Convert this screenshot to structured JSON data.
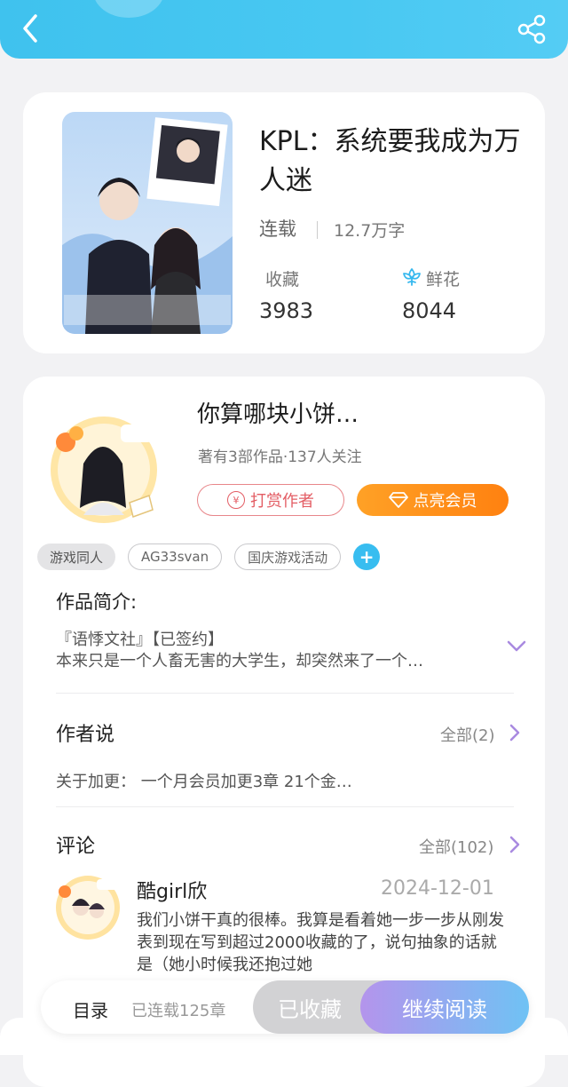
{
  "colors": {
    "header": "#45c6f1",
    "accent_orange": "#ff8a1a",
    "accent_red": "#e35d64",
    "tag_blue": "#38bdf0",
    "read_gradient_start": "#b494ec",
    "read_gradient_end": "#6fc2f4"
  },
  "header": {
    "back_icon": "chevron-left-icon",
    "share_icon": "share-icon"
  },
  "book": {
    "title": "KPL：系统要我成为万人迷",
    "status": "连载",
    "words": "12.7万字",
    "favorites_label": "收藏",
    "favorites_count": "3983",
    "flowers_label": "鲜花",
    "flowers_count": "8044"
  },
  "author": {
    "name": "你算哪块小饼…",
    "meta": "著有3部作品·137人关注",
    "tip_button": "打赏作者",
    "vip_button": "点亮会员"
  },
  "tags": [
    "游戏同人",
    "AG33svan",
    "国庆游戏活动"
  ],
  "intro": {
    "title": "作品简介:",
    "line1": "『语悸文社』【已签约】",
    "line2": "本来只是一个人畜无害的大学生，却突然来了一个…"
  },
  "author_note": {
    "title": "作者说",
    "see_all": "全部(2)",
    "text": "关于加更：  一个月会员加更3章 21个金…"
  },
  "comments": {
    "title": "评论",
    "see_all": "全部(102)",
    "first": {
      "user": "酷girl欣",
      "date": "2024-12-01",
      "text": "我们小饼干真的很棒。我算是看着她一步一步从刚发表到现在写到超过2000收藏的了，说句抽象的话就是（她小时候我还抱过她"
    }
  },
  "bottom_bar": {
    "toc": "目录",
    "serial": "已连载125章",
    "collected": "已收藏",
    "continue": "继续阅读"
  }
}
